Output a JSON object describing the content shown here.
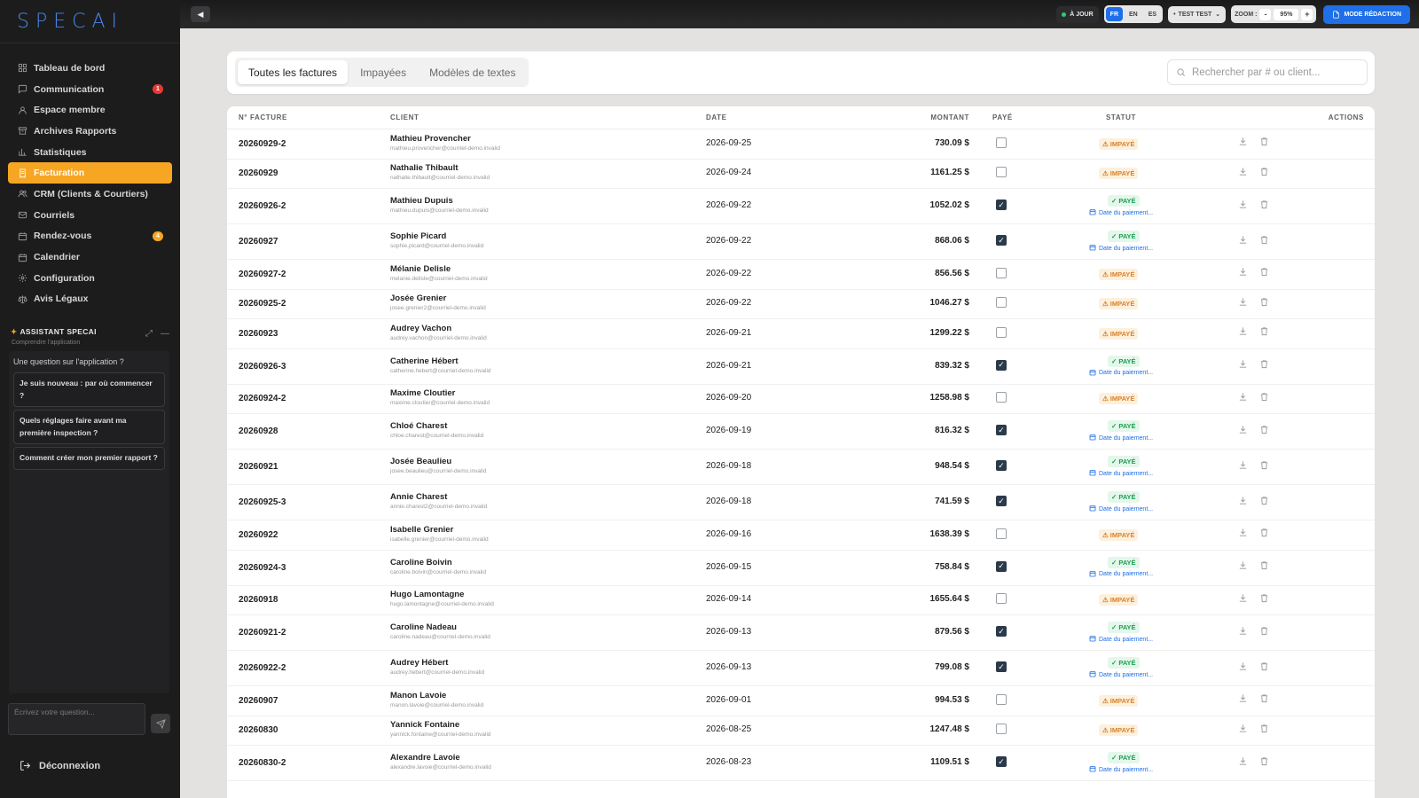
{
  "app": {
    "logo": "SPECAI"
  },
  "sidebar": {
    "items": [
      {
        "label": "Tableau de bord",
        "icon": "dashboard-icon",
        "badge": "",
        "active": false
      },
      {
        "label": "Communication",
        "icon": "chat-icon",
        "badge": "1",
        "active": false
      },
      {
        "label": "Espace membre",
        "icon": "user-icon",
        "badge": "",
        "active": false
      },
      {
        "label": "Archives Rapports",
        "icon": "archive-icon",
        "badge": "",
        "active": false
      },
      {
        "label": "Statistiques",
        "icon": "chart-icon",
        "badge": "",
        "active": false
      },
      {
        "label": "Facturation",
        "icon": "invoice-icon",
        "badge": "",
        "active": true
      },
      {
        "label": "CRM (Clients & Courtiers)",
        "icon": "users-icon",
        "badge": "",
        "active": false
      },
      {
        "label": "Courriels",
        "icon": "mail-icon",
        "badge": "",
        "active": false
      },
      {
        "label": "Rendez-vous",
        "icon": "calendar-icon",
        "badge": "4",
        "active": false
      },
      {
        "label": "Calendrier",
        "icon": "calendar-icon",
        "badge": "",
        "active": false
      },
      {
        "label": "Configuration",
        "icon": "gear-icon",
        "badge": "",
        "active": false
      },
      {
        "label": "Avis Légaux",
        "icon": "scale-icon",
        "badge": "",
        "active": false
      }
    ],
    "logout_label": "Déconnexion"
  },
  "assistant": {
    "title": "ASSISTANT SPECAI",
    "subtitle": "Comprendre l'application",
    "question": "Une question sur l'application ?",
    "suggestions": [
      "Je suis nouveau : par où commencer ?",
      "Quels réglages faire avant ma première inspection ?",
      "Comment créer mon premier rapport ?"
    ],
    "input_placeholder": "Écrivez votre question..."
  },
  "topbar": {
    "status": "À JOUR",
    "languages": [
      "FR",
      "EN",
      "ES"
    ],
    "active_language": "FR",
    "user": "TEST TEST",
    "zoom_label": "ZOOM :",
    "zoom_value": "95%",
    "zoom_minus": "-",
    "zoom_plus": "+",
    "redact_label": "MODE RÉDACTION"
  },
  "tabs": [
    {
      "label": "Toutes les factures",
      "active": true
    },
    {
      "label": "Impayées",
      "active": false
    },
    {
      "label": "Modèles de textes",
      "active": false
    }
  ],
  "search": {
    "placeholder": "Rechercher par # ou client..."
  },
  "table": {
    "headers": {
      "invoice": "N° FACTURE",
      "client": "CLIENT",
      "date": "DATE",
      "amount": "MONTANT",
      "paid": "PAYÉ",
      "status": "STATUT",
      "actions": "ACTIONS"
    },
    "paid_label": "✓ PAYÉ",
    "unpaid_label": "⚠ IMPAYÉ",
    "pay_date_label": "Date du paiement...",
    "rows": [
      {
        "invoice": "20260929-2",
        "name": "Mathieu Provencher",
        "email": "mathieu.provencher@courriel-demo.invalid",
        "date": "2026-09-25",
        "amount": "730.09 $",
        "paid": false
      },
      {
        "invoice": "20260929",
        "name": "Nathalie Thibault",
        "email": "nathalie.thibault@courriel-demo.invalid",
        "date": "2026-09-24",
        "amount": "1161.25 $",
        "paid": false
      },
      {
        "invoice": "20260926-2",
        "name": "Mathieu Dupuis",
        "email": "mathieu.dupuis@courriel-demo.invalid",
        "date": "2026-09-22",
        "amount": "1052.02 $",
        "paid": true
      },
      {
        "invoice": "20260927",
        "name": "Sophie Picard",
        "email": "sophie.picard@courriel-demo.invalid",
        "date": "2026-09-22",
        "amount": "868.06 $",
        "paid": true
      },
      {
        "invoice": "20260927-2",
        "name": "Mélanie Delisle",
        "email": "melanie.delisle@courriel-demo.invalid",
        "date": "2026-09-22",
        "amount": "856.56 $",
        "paid": false
      },
      {
        "invoice": "20260925-2",
        "name": "Josée Grenier",
        "email": "josee.grenier2@courriel-demo.invalid",
        "date": "2026-09-22",
        "amount": "1046.27 $",
        "paid": false
      },
      {
        "invoice": "20260923",
        "name": "Audrey Vachon",
        "email": "audrey.vachon@courriel-demo.invalid",
        "date": "2026-09-21",
        "amount": "1299.22 $",
        "paid": false
      },
      {
        "invoice": "20260926-3",
        "name": "Catherine Hébert",
        "email": "catherine.hebert@courriel-demo.invalid",
        "date": "2026-09-21",
        "amount": "839.32 $",
        "paid": true
      },
      {
        "invoice": "20260924-2",
        "name": "Maxime Cloutier",
        "email": "maxime.cloutier@courriel-demo.invalid",
        "date": "2026-09-20",
        "amount": "1258.98 $",
        "paid": false
      },
      {
        "invoice": "20260928",
        "name": "Chloé Charest",
        "email": "chloe.charest@courriel-demo.invalid",
        "date": "2026-09-19",
        "amount": "816.32 $",
        "paid": true
      },
      {
        "invoice": "20260921",
        "name": "Josée Beaulieu",
        "email": "josee.beaulieu@courriel-demo.invalid",
        "date": "2026-09-18",
        "amount": "948.54 $",
        "paid": true
      },
      {
        "invoice": "20260925-3",
        "name": "Annie Charest",
        "email": "annie.charest2@courriel-demo.invalid",
        "date": "2026-09-18",
        "amount": "741.59 $",
        "paid": true
      },
      {
        "invoice": "20260922",
        "name": "Isabelle Grenier",
        "email": "isabelle.grenier@courriel-demo.invalid",
        "date": "2026-09-16",
        "amount": "1638.39 $",
        "paid": false
      },
      {
        "invoice": "20260924-3",
        "name": "Caroline Boivin",
        "email": "caroline.boivin@courriel-demo.invalid",
        "date": "2026-09-15",
        "amount": "758.84 $",
        "paid": true
      },
      {
        "invoice": "20260918",
        "name": "Hugo Lamontagne",
        "email": "hugo.lamontagne@courriel-demo.invalid",
        "date": "2026-09-14",
        "amount": "1655.64 $",
        "paid": false
      },
      {
        "invoice": "20260921-2",
        "name": "Caroline Nadeau",
        "email": "caroline.nadeau@courriel-demo.invalid",
        "date": "2026-09-13",
        "amount": "879.56 $",
        "paid": true
      },
      {
        "invoice": "20260922-2",
        "name": "Audrey Hébert",
        "email": "audrey.hebert@courriel-demo.invalid",
        "date": "2026-09-13",
        "amount": "799.08 $",
        "paid": true
      },
      {
        "invoice": "20260907",
        "name": "Manon Lavoie",
        "email": "manon.lavoie@courriel-demo.invalid",
        "date": "2026-09-01",
        "amount": "994.53 $",
        "paid": false
      },
      {
        "invoice": "20260830",
        "name": "Yannick Fontaine",
        "email": "yannick.fontaine@courriel-demo.invalid",
        "date": "2026-08-25",
        "amount": "1247.48 $",
        "paid": false
      },
      {
        "invoice": "20260830-2",
        "name": "Alexandre Lavoie",
        "email": "alexandre.lavoie@courriel-demo.invalid",
        "date": "2026-08-23",
        "amount": "1109.51 $",
        "paid": true
      }
    ]
  },
  "colors": {
    "accent": "#f6a623",
    "primary_blue": "#1e6fe8",
    "paid_green": "#1f9d55",
    "unpaid_orange": "#d9822b",
    "sidebar_bg": "#1c1c1d"
  }
}
